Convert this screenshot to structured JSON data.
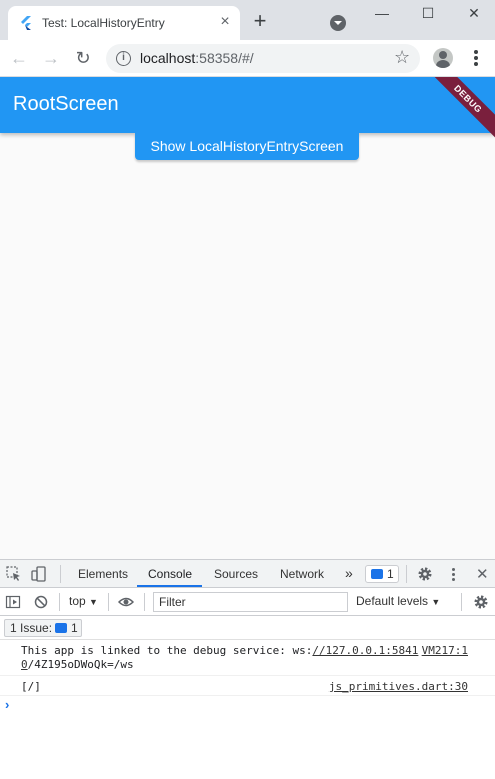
{
  "browser": {
    "tab_title": "Test: LocalHistoryEntry",
    "tab_close": "×",
    "new_tab": "+",
    "url_host": "localhost",
    "url_rest": ":58358/#/",
    "info_glyph": "i",
    "star_glyph": "☆",
    "back_glyph": "←",
    "forward_glyph": "→",
    "reload_glyph": "↻",
    "minimize_glyph": "—",
    "maximize_glyph": "☐",
    "close_glyph": "✕",
    "flutter_color": "#42a5f5"
  },
  "app": {
    "title": "RootScreen",
    "debug_banner": "DEBUG",
    "show_button": "Show LocalHistoryEntryScreen",
    "primary_color": "#2196f3"
  },
  "devtools": {
    "tabs": [
      "Elements",
      "Console",
      "Sources",
      "Network"
    ],
    "more_tabs": "»",
    "issues_count": "1",
    "context": "top",
    "dropdown_glyph": "▼",
    "filter_placeholder": "Filter",
    "levels": "Default levels",
    "issues_label": "1 Issue:",
    "issues_badge_count": "1",
    "messages": [
      {
        "text_prefix": "This app is linked to the debug service: ws:",
        "link": "//127.0.0.1:5841",
        "link_cont": "0",
        "text_suffix": "/4Z195oDWoQk=/ws",
        "source": "VM217:1"
      },
      {
        "text": "[/]",
        "source": "js_primitives.dart:30"
      }
    ],
    "prompt": "›"
  }
}
